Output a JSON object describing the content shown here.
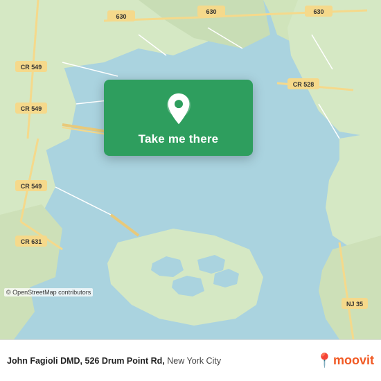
{
  "map": {
    "attribution": "© OpenStreetMap contributors",
    "background_color": "#aad3df"
  },
  "location_card": {
    "button_label": "Take me there"
  },
  "footer": {
    "address": "John Fagioli DMD, 526 Drum Point Rd,",
    "city": "New York City",
    "logo_text": "moovit"
  }
}
